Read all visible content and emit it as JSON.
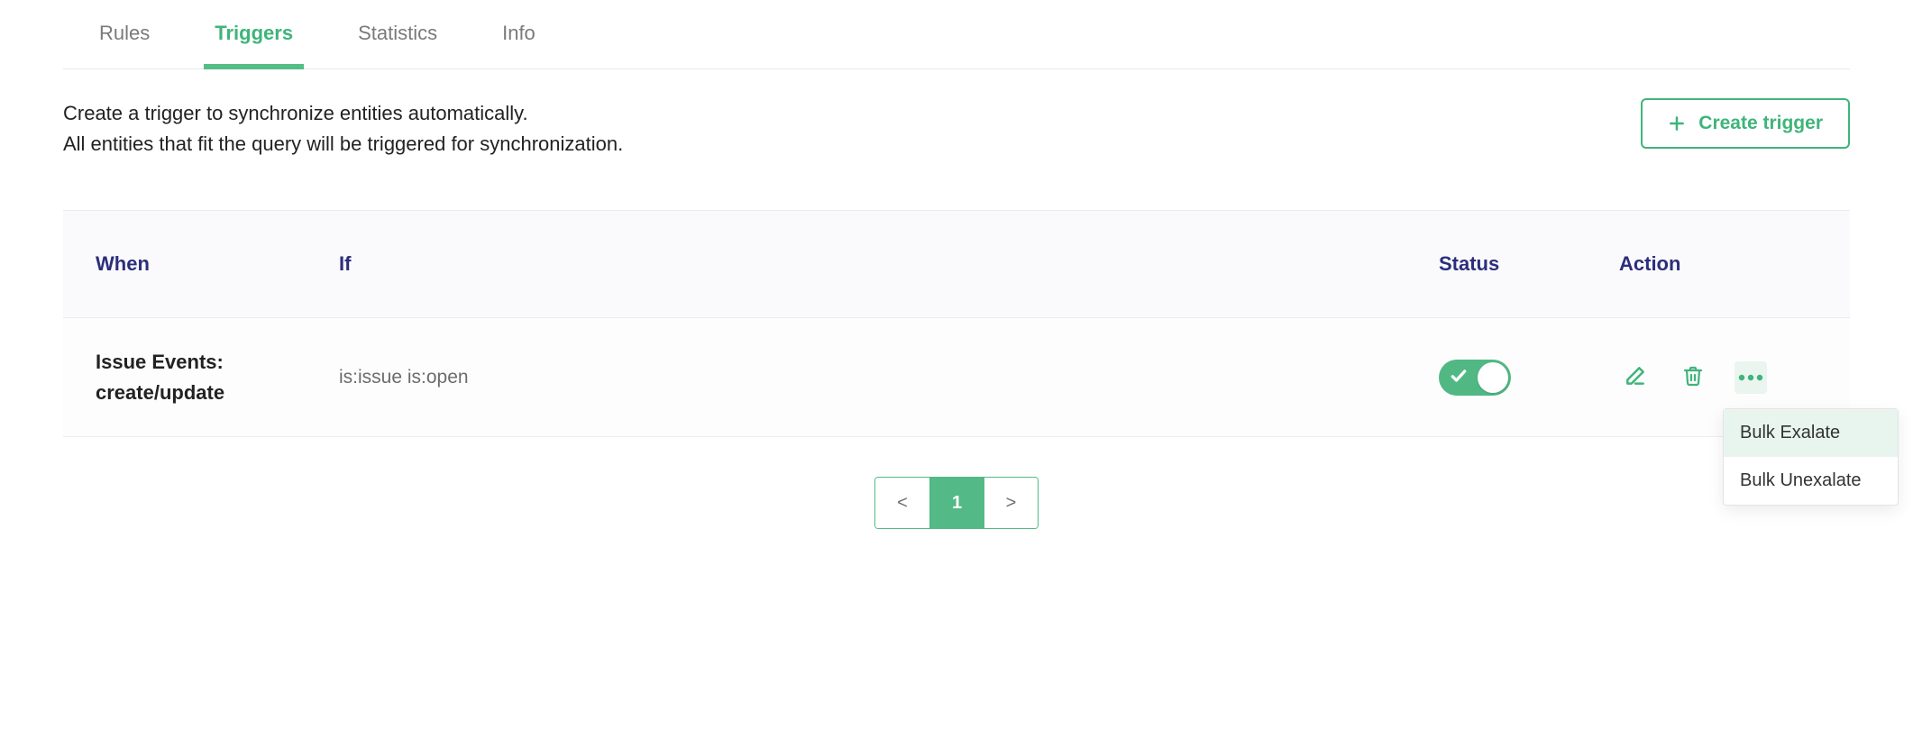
{
  "tabs": {
    "items": [
      {
        "label": "Rules",
        "active": false
      },
      {
        "label": "Triggers",
        "active": true
      },
      {
        "label": "Statistics",
        "active": false
      },
      {
        "label": "Info",
        "active": false
      }
    ]
  },
  "description": {
    "line1": "Create a trigger to synchronize entities automatically.",
    "line2": "All entities that fit the query will be triggered for synchronization."
  },
  "create_button_label": "Create trigger",
  "columns": {
    "when": "When",
    "if": "If",
    "status": "Status",
    "action": "Action"
  },
  "rows": [
    {
      "when_line1": "Issue Events:",
      "when_line2": "create/update",
      "if": "is:issue is:open",
      "status_on": true
    }
  ],
  "row_menu": {
    "items": [
      {
        "label": "Bulk Exalate",
        "highlight": true
      },
      {
        "label": "Bulk Unexalate",
        "highlight": false
      }
    ]
  },
  "pagination": {
    "prev": "<",
    "pages": [
      "1"
    ],
    "next": ">",
    "current": "1"
  },
  "colors": {
    "accent": "#3fb47a",
    "header_text": "#2c2e7b"
  }
}
